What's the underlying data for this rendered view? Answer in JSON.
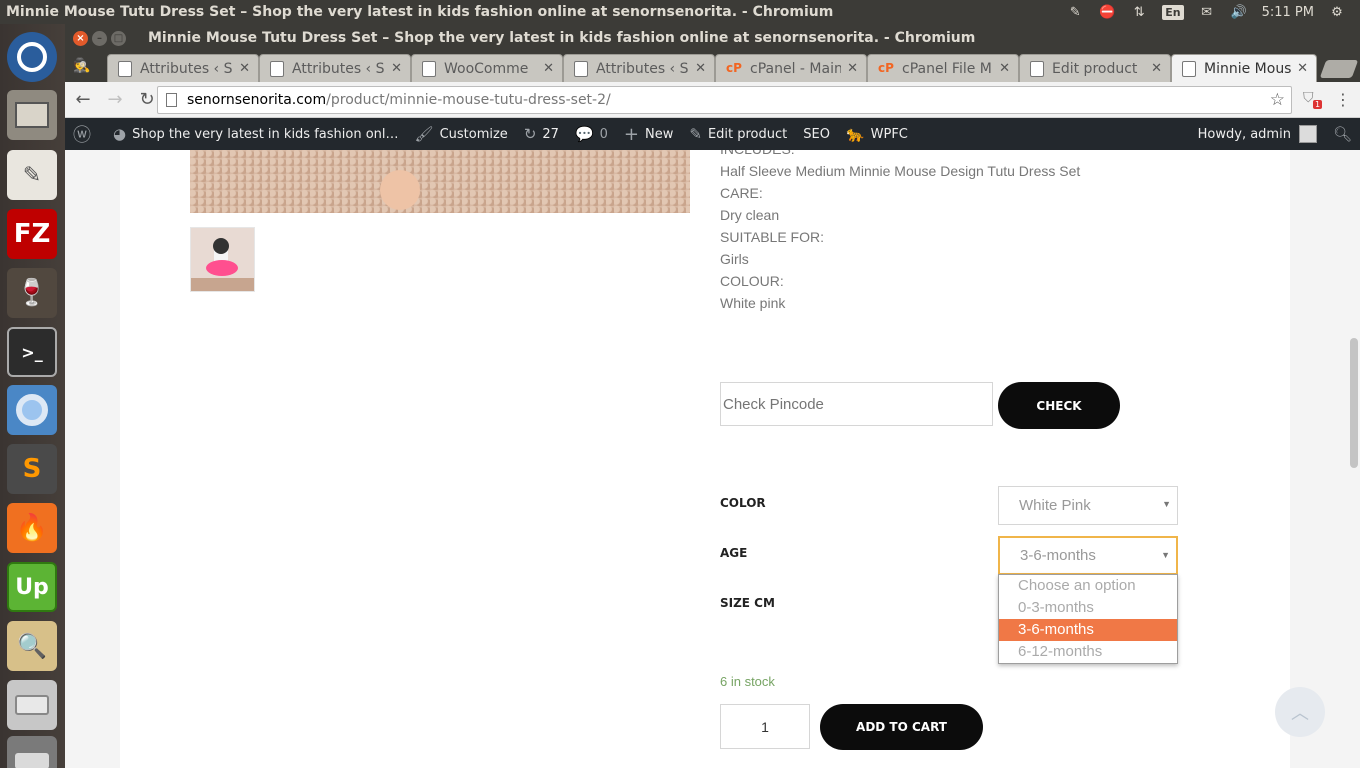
{
  "os": {
    "window_title": "Minnie Mouse Tutu Dress Set – Shop the very latest in kids fashion online at senornsenorita. - Chromium",
    "language": "En",
    "clock": "5:11 PM"
  },
  "launcher": {
    "items": [
      "ubuntu-dash",
      "files",
      "text-editor",
      "filezilla",
      "wine",
      "terminal",
      "chromium",
      "sublime-text",
      "hotshots",
      "upwork",
      "image-viewer",
      "disks",
      "usb-drive"
    ],
    "filezilla_label": "FZ",
    "upwork_label": "Up",
    "sublime_label": "S",
    "terminal_label": ">_"
  },
  "browser": {
    "title": "Minnie Mouse Tutu Dress Set – Shop the very latest in kids fashion online at senornsenorita. - Chromium",
    "tabs": [
      {
        "label": "Attributes ‹ S",
        "icon": "page-icon",
        "active": false
      },
      {
        "label": "Attributes ‹ S",
        "icon": "page-icon",
        "active": false
      },
      {
        "label": "WooComme",
        "icon": "page-icon",
        "active": false
      },
      {
        "label": "Attributes ‹ S",
        "icon": "page-icon",
        "active": false
      },
      {
        "label": "cPanel - Main",
        "icon": "cpanel-icon",
        "active": false
      },
      {
        "label": "cPanel File M",
        "icon": "cpanel-icon",
        "active": false
      },
      {
        "label": "Edit product",
        "icon": "page-icon",
        "active": false
      },
      {
        "label": "Minnie Mous",
        "icon": "page-icon",
        "active": true
      }
    ],
    "url_host": "senornsenorita.com",
    "url_path": "/product/minnie-mouse-tutu-dress-set-2/",
    "extension_badge": "1"
  },
  "adminbar": {
    "site_name": "Shop the very latest in kids fashion onl…",
    "customize": "Customize",
    "updates_count": "27",
    "comments_count": "0",
    "new": "New",
    "edit_product": "Edit product",
    "seo": "SEO",
    "wpfc": "WPFC",
    "howdy": "Howdy, admin"
  },
  "product": {
    "description_lines": [
      "INCLUDES:",
      "Half Sleeve Medium Minnie Mouse Design Tutu Dress Set",
      "CARE:",
      "Dry clean",
      "SUITABLE FOR:",
      "Girls",
      "COLOUR:",
      "White pink"
    ],
    "pincode_placeholder": "Check Pincode",
    "check_label": "CHECK",
    "variations": {
      "color_label": "COLOR",
      "color_value": "White Pink",
      "age_label": "AGE",
      "age_value": "3-6-months",
      "size_label": "SIZE CM"
    },
    "age_options": [
      "Choose an option",
      "0-3-months",
      "3-6-months",
      "6-12-months"
    ],
    "age_selected": "3-6-months",
    "stock": "6 in stock",
    "quantity": "1",
    "add_to_cart": "ADD TO CART"
  },
  "colors": {
    "accent_orange": "#f07846",
    "stock_green": "#77a464",
    "button_black": "#0c0c0c",
    "adminbar_bg": "#23282d"
  }
}
